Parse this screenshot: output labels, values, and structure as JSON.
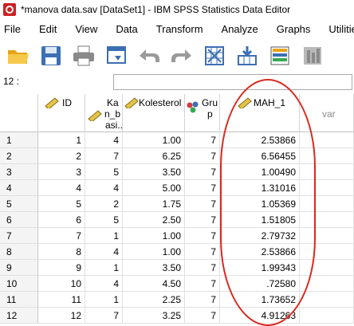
{
  "window": {
    "title": "*manova data.sav [DataSet1] - IBM SPSS Statistics Data Editor"
  },
  "menu": [
    "File",
    "Edit",
    "View",
    "Data",
    "Transform",
    "Analyze",
    "Graphs",
    "Utilities"
  ],
  "toolbar": {
    "icons": [
      "open-folder-icon",
      "save-icon",
      "print-icon",
      "dialog-recall-icon",
      "undo-icon",
      "redo-icon",
      "goto-case-icon",
      "goto-variable-icon",
      "variables-icon",
      "split-file-icon"
    ]
  },
  "cell_editor": {
    "cell_ref": "12 :",
    "value": ""
  },
  "columns": {
    "id": "ID",
    "kan": [
      "Ka",
      "n_b",
      "asi..."
    ],
    "kolesterol": "Kolesterol",
    "grup": [
      "Gru",
      "p"
    ],
    "mah": "MAH_1",
    "var": "var"
  },
  "rows": [
    {
      "n": "1",
      "id": "1",
      "kan": "4",
      "kol": "1.00",
      "grup": "7",
      "mah": "2.53866"
    },
    {
      "n": "2",
      "id": "2",
      "kan": "7",
      "kol": "6.25",
      "grup": "7",
      "mah": "6.56455"
    },
    {
      "n": "3",
      "id": "3",
      "kan": "5",
      "kol": "3.50",
      "grup": "7",
      "mah": "1.00490"
    },
    {
      "n": "4",
      "id": "4",
      "kan": "4",
      "kol": "5.00",
      "grup": "7",
      "mah": "1.31016"
    },
    {
      "n": "5",
      "id": "5",
      "kan": "2",
      "kol": "1.75",
      "grup": "7",
      "mah": "1.05369"
    },
    {
      "n": "6",
      "id": "6",
      "kan": "5",
      "kol": "2.50",
      "grup": "7",
      "mah": "1.51805"
    },
    {
      "n": "7",
      "id": "7",
      "kan": "1",
      "kol": "1.00",
      "grup": "7",
      "mah": "2.79732"
    },
    {
      "n": "8",
      "id": "8",
      "kan": "4",
      "kol": "1.00",
      "grup": "7",
      "mah": "2.53866"
    },
    {
      "n": "9",
      "id": "9",
      "kan": "1",
      "kol": "3.50",
      "grup": "7",
      "mah": "1.99343"
    },
    {
      "n": "10",
      "id": "10",
      "kan": "4",
      "kol": "4.50",
      "grup": "7",
      "mah": ".72580"
    },
    {
      "n": "11",
      "id": "11",
      "kan": "1",
      "kol": "2.25",
      "grup": "7",
      "mah": "1.73652"
    },
    {
      "n": "12",
      "id": "12",
      "kan": "7",
      "kol": "3.25",
      "grup": "7",
      "mah": "4.91263"
    }
  ],
  "annotation": {
    "color": "#d9281f",
    "shape": "hand-drawn-ellipse-around-MAH_1"
  }
}
